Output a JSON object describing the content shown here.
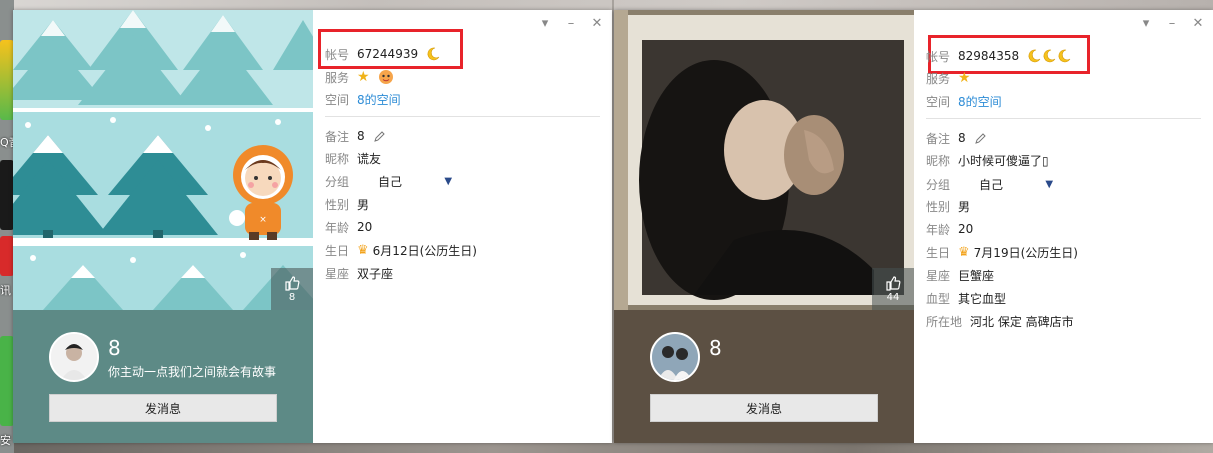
{
  "desktop": {
    "labels": [
      "Q音",
      "讯",
      "安"
    ]
  },
  "left_card": {
    "like_count": "8",
    "nickname": "8",
    "signature": "你主动一点我们之间就会有故事",
    "message_button": "发消息",
    "account_label": "帐号",
    "account": "67244939",
    "service_label": "服务",
    "space_label": "空间",
    "space_link": "8的空间",
    "remark_label": "备注",
    "remark": "8",
    "nick_label": "昵称",
    "nick": "谎友",
    "group_label": "分组",
    "group": "自己",
    "gender_label": "性别",
    "gender": "男",
    "age_label": "年龄",
    "age": "20",
    "birthday_label": "生日",
    "birthday": "6月12日(公历生日)",
    "zodiac_label": "星座",
    "zodiac": "双子座"
  },
  "right_card": {
    "like_count": "44",
    "nickname": "8",
    "message_button": "发消息",
    "account_label": "帐号",
    "account": "82984358",
    "service_label": "服务",
    "space_label": "空间",
    "space_link": "8的空间",
    "remark_label": "备注",
    "remark": "8",
    "nick_label": "昵称",
    "nick": "小时候可傻逼了▯",
    "group_label": "分组",
    "group": "自己",
    "gender_label": "性别",
    "gender": "男",
    "age_label": "年龄",
    "age": "20",
    "birthday_label": "生日",
    "birthday": "7月19日(公历生日)",
    "zodiac_label": "星座",
    "zodiac": "巨蟹座",
    "blood_label": "血型",
    "blood": "其它血型",
    "location_label": "所在地",
    "location": "河北 保定 高碑店市"
  },
  "icons": {
    "moon": "crescent-moon-icon",
    "crown": "crown-icon",
    "edit": "pencil-icon",
    "thumb": "thumbs-up-icon"
  },
  "colors": {
    "left_bottom": "#5d8a86",
    "right_bottom": "#5c5043",
    "highlight": "#e8232a",
    "link": "#2d8cd6"
  }
}
